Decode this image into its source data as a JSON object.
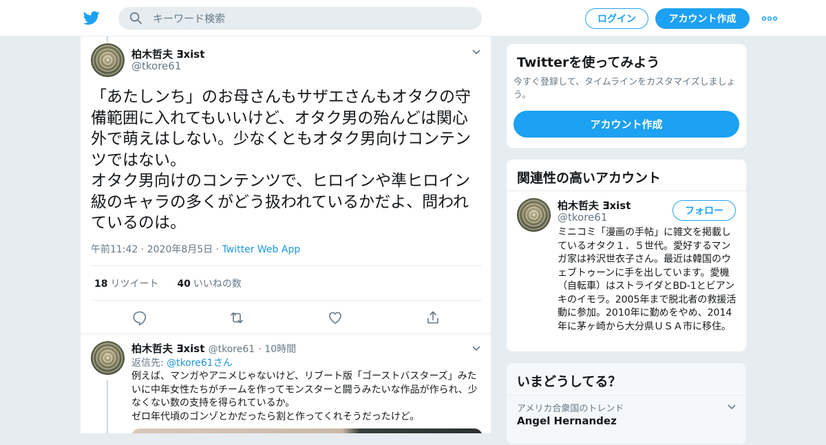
{
  "header": {
    "search_placeholder": "キーワード検索",
    "login_label": "ログイン",
    "signup_label": "アカウント作成",
    "brand_color": "#1da1f2"
  },
  "tweet": {
    "author_name": "柏木哲夫 Ǝxist",
    "author_handle": "@tkore61",
    "text": "「あたしンち」のお母さんもサザエさんもオタクの守備範囲に入れてもいいけど、オタク男の殆んどは関心外で萌えはしない。少なくともオタク男向けコンテンツではない。\nオタク男向けのコンテンツで、ヒロインや準ヒロイン級のキャラの多くがどう扱われているかだよ、問われているのは。",
    "time": "午前11:42",
    "date": "2020年8月5日",
    "source": "Twitter Web App",
    "retweet_count": "18",
    "retweet_label": "リツイート",
    "like_count": "40",
    "like_label": "いいねの数"
  },
  "reply": {
    "author_name": "柏木哲夫 Ǝxist",
    "author_handle": "@tkore61",
    "age": "10時間",
    "reply_to_label": "返信先:",
    "reply_to_handle": "@tkore61",
    "reply_to_suffix": "さん",
    "text": "例えば、マンガやアニメじゃないけど、リブート版「ゴーストバスターズ」みたいに中年女性たちがチームを作ってモンスターと闘うみたいな作品が作られ、少なくない数の支持を得られているか。\nゼロ年代頃のゴンゾとかだったら割と作ってくれそうだったけど。"
  },
  "signup_card": {
    "title": "Twitterを使ってみよう",
    "subtitle": "今すぐ登録して、タイムラインをカスタマイズしましょう。",
    "button_label": "アカウント作成"
  },
  "related_card": {
    "title": "関連性の高いアカウント",
    "name": "柏木哲夫 Ǝxist",
    "handle": "@tkore61",
    "follow_label": "フォロー",
    "bio": "ミニコミ「漫画の手帖」に雑文を掲載しているオタク１．５世代。愛好するマンガ家は衿沢世衣子さん。最近は韓国のウェブトゥーンに手を出しています。愛機（自転車）はストライダとBD-1とビアンキのイモラ。2005年まで脱北者の救援活動に参加。2010年に勤めをやめ、2014年に茅ヶ崎から大分県ＵＳＡ市に移住。"
  },
  "trends_card": {
    "title": "いまどうしてる？",
    "trend_context": "アメリカ合衆国のトレンド",
    "trend_name": "Angel Hernandez"
  }
}
